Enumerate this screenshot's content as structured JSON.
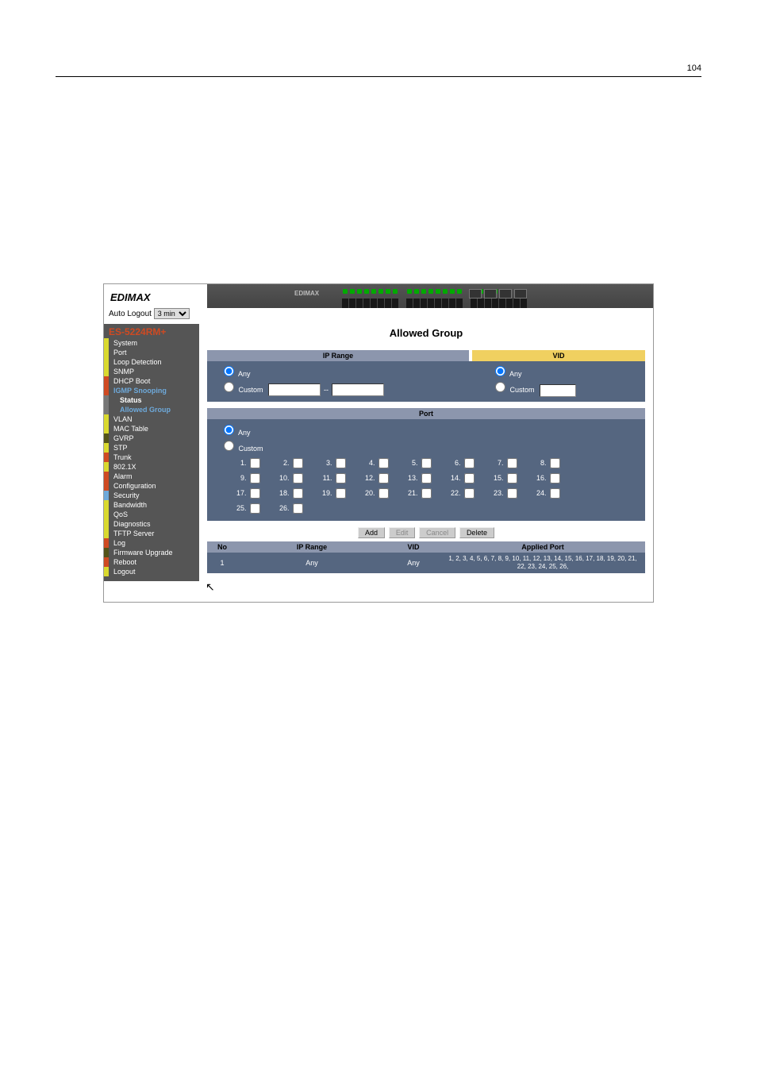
{
  "page_number": "104",
  "logo_text": "EDIMAX",
  "auto_logout": {
    "label": "Auto Logout",
    "options": [
      "3 min"
    ],
    "selected": "3 min"
  },
  "nav": {
    "title": "ES-5224RM+",
    "items": {
      "system": "System",
      "port": "Port",
      "loop": "Loop Detection",
      "snmp": "SNMP",
      "dhcp": "DHCP Boot",
      "igmp": "IGMP Snooping",
      "igmp_status": "Status",
      "igmp_allowed": "Allowed Group",
      "vlan": "VLAN",
      "mac": "MAC Table",
      "gvrp": "GVRP",
      "stp": "STP",
      "trunk": "Trunk",
      "x8021": "802.1X",
      "alarm": "Alarm",
      "config": "Configuration",
      "sec": "Security",
      "bw": "Bandwidth",
      "qos": "QoS",
      "diag": "Diagnostics",
      "tftp": "TFTP Server",
      "log": "Log",
      "fw": "Firmware Upgrade",
      "reboot": "Reboot",
      "logout": "Logout"
    }
  },
  "content": {
    "title": "Allowed Group",
    "ip_header": "IP Range",
    "vid_header": "VID",
    "port_header": "Port",
    "option_any": "Any",
    "option_custom": "Custom",
    "ip_dash": "--",
    "port_count": 26,
    "buttons": {
      "add": "Add",
      "edit": "Edit",
      "cancel": "Cancel",
      "delete": "Delete"
    },
    "table": {
      "headers": {
        "no": "No",
        "ip": "IP Range",
        "vid": "VID",
        "ports": "Applied Port"
      },
      "rows": [
        {
          "no": "1",
          "ip": "Any",
          "vid": "Any",
          "ports": "1, 2, 3, 4, 5, 6, 7, 8, 9, 10, 11, 12, 13, 14, 15, 16, 17, 18, 19, 20, 21, 22, 23, 24, 25, 26,"
        }
      ]
    }
  }
}
